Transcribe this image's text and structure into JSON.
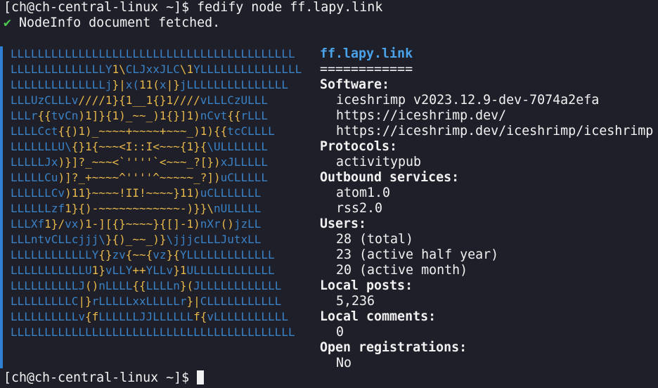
{
  "terminal": {
    "prompt": "[ch@ch-central-linux ~]$",
    "command": "fedify node ff.lapy.link",
    "success_mark": "✔",
    "success_message": "NodeInfo document fetched.",
    "final_prompt": "[ch@ch-central-linux ~]$"
  },
  "colors": {
    "background": "#1e1f29",
    "text": "#f2f2f2",
    "art_blue": "#3a82c6",
    "art_yellow": "#e8b84a",
    "host_blue": "#4aa3e8",
    "check_green": "#4ec94e",
    "gutter_blue": "#2f7fd4"
  },
  "art_lines": [
    [
      [
        "b",
        "LLLLLLLLLLLLLLLLLLLLLLLLLLLLLLLLLLLLLLLLLL"
      ]
    ],
    [
      [
        "b",
        "LLLLLLLLLLLLLLY"
      ],
      [
        "y",
        "1\\"
      ],
      [
        "b",
        "CLJxxJLC"
      ],
      [
        "y",
        "\\1"
      ],
      [
        "b",
        "YLLLLLLLLLLLLLLL"
      ]
    ],
    [
      [
        "b",
        "LLLLLLLLLLLLLLj"
      ],
      [
        "y",
        "}|"
      ],
      [
        "b",
        "x("
      ],
      [
        "y",
        "11("
      ],
      [
        "b",
        "x"
      ],
      [
        "y",
        "|}"
      ],
      [
        "b",
        "jLLLLLLLLLLLLLLL"
      ]
    ],
    [
      [
        "b",
        "LLLUzCLLLv"
      ],
      [
        "y",
        "////1}{1__1{}1////"
      ],
      [
        "b",
        "vLLLCzULLL"
      ]
    ],
    [
      [
        "b",
        "LLLr"
      ],
      [
        "y",
        "{{"
      ],
      [
        "b",
        "tvCn"
      ],
      [
        "y",
        ")1]}{1)_~~_)1{}]1)"
      ],
      [
        "b",
        "nCvt"
      ],
      [
        "y",
        "{{"
      ],
      [
        "b",
        "rLLL"
      ]
    ],
    [
      [
        "b",
        "LLLLCct"
      ],
      [
        "y",
        "{{)1)_~~~~+~~~~+~~~_)1){{"
      ],
      [
        "b",
        "tcCLLLL"
      ]
    ],
    [
      [
        "b",
        "LLLLLLLU\\"
      ],
      [
        "y",
        "{}1{~~~<I::I<~~~{1}{"
      ],
      [
        "b",
        "\\ULLLLLLL"
      ]
    ],
    [
      [
        "b",
        "LLLLLJx"
      ],
      [
        "y",
        ")}]?_~~~<`''''`<~~~_?[})"
      ],
      [
        "b",
        "xJLLLLL"
      ]
    ],
    [
      [
        "b",
        "LLLLLCu"
      ],
      [
        "y",
        ")]?_+~~~~^''''^~~~~~_?])"
      ],
      [
        "b",
        "uCLLLLL"
      ]
    ],
    [
      [
        "b",
        "LLLLLLCv"
      ],
      [
        "y",
        ")11}~~~~!II!~~~~}11)"
      ],
      [
        "b",
        "uCLLLLLLL"
      ]
    ],
    [
      [
        "b",
        "LLLLLLzf"
      ],
      [
        "y",
        "1}{)-~~~~~~~~~~~~-)}}\\"
      ],
      [
        "b",
        "nULLLLL"
      ]
    ],
    [
      [
        "b",
        "LLLXf"
      ],
      [
        "y",
        "1}/"
      ],
      [
        "b",
        "vx"
      ],
      [
        "y",
        ")1-][{}~~~~}{[]-1)"
      ],
      [
        "b",
        "nXr"
      ],
      [
        "y",
        "()"
      ],
      [
        "b",
        "jzLL"
      ]
    ],
    [
      [
        "b",
        "LLLntvCLLcjjj\\"
      ],
      [
        "y",
        "}{)_~~_)}"
      ],
      [
        "b",
        "\\jjjcLLLJutxLL"
      ]
    ],
    [
      [
        "b",
        "LLLLLLLLLLLLY"
      ],
      [
        "y",
        "{}"
      ],
      [
        "b",
        "zv"
      ],
      [
        "y",
        "{~~{"
      ],
      [
        "b",
        "vz"
      ],
      [
        "y",
        "}{"
      ],
      [
        "b",
        "YLLLLLLLLLLLLL"
      ]
    ],
    [
      [
        "b",
        "LLLLLLLLLLLU"
      ],
      [
        "y",
        "1}"
      ],
      [
        "b",
        "vLLY"
      ],
      [
        "y",
        "++"
      ],
      [
        "b",
        "YLLv"
      ],
      [
        "y",
        "}1"
      ],
      [
        "b",
        "ULLLLLLLLLLLL"
      ]
    ],
    [
      [
        "b",
        "LLLLLLLLLLJ"
      ],
      [
        "y",
        "()"
      ],
      [
        "b",
        "nLLLL"
      ],
      [
        "y",
        "{{"
      ],
      [
        "b",
        "LLLLn"
      ],
      [
        "y",
        "}("
      ],
      [
        "b",
        "JLLLLLLLLLLLL"
      ]
    ],
    [
      [
        "b",
        "LLLLLLLLLC"
      ],
      [
        "y",
        "|}"
      ],
      [
        "b",
        "rLLLLLxxLLLLLr"
      ],
      [
        "y",
        "}|"
      ],
      [
        "b",
        "CLLLLLLLLLLL"
      ]
    ],
    [
      [
        "b",
        "LLLLLLLLLLv"
      ],
      [
        "y",
        "{f"
      ],
      [
        "b",
        "LLLLLLJJLLLLLL"
      ],
      [
        "y",
        "f{"
      ],
      [
        "b",
        "vLLLLLLLLLLL"
      ]
    ],
    [
      [
        "b",
        "LLLLLLLLLLLLLLLLLLLLLLLLLLLLLLLLLLLLLLLLLL"
      ]
    ]
  ],
  "node": {
    "host": "ff.lapy.link",
    "underline": "============",
    "software_label": "Software:",
    "software_name_version": "iceshrimp v2023.12.9-dev-7074a2efa",
    "software_homepage": "https://iceshrimp.dev/",
    "software_repository": "https://iceshrimp.dev/iceshrimp/iceshrimp",
    "protocols_label": "Protocols:",
    "protocols": [
      "activitypub"
    ],
    "outbound_label": "Outbound services:",
    "outbound": [
      "atom1.0",
      "rss2.0"
    ],
    "users_label": "Users:",
    "users_total": "28 (total)",
    "users_active_half_year": "23 (active half year)",
    "users_active_month": "20 (active month)",
    "local_posts_label": "Local posts:",
    "local_posts": "5,236",
    "local_comments_label": "Local comments:",
    "local_comments": "0",
    "open_registrations_label": "Open registrations:",
    "open_registrations": "No"
  }
}
